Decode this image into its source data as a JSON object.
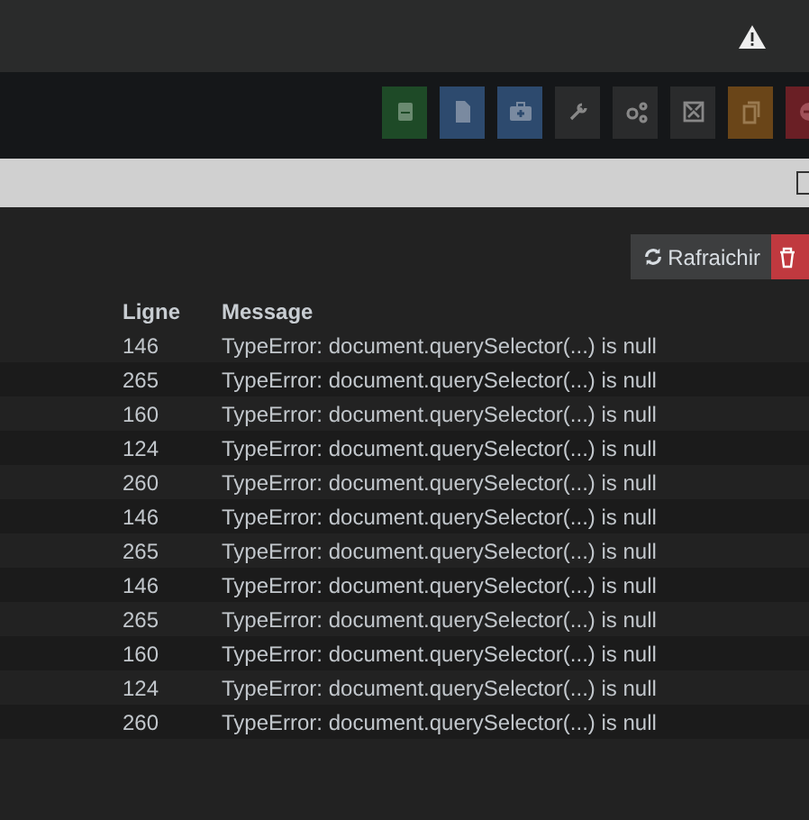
{
  "toolbar": {
    "buttons": [
      {
        "kind": "drive",
        "color": "#1e4a27"
      },
      {
        "kind": "file",
        "color": "#2d4a6e"
      },
      {
        "kind": "case",
        "color": "#2d4a6e"
      },
      {
        "kind": "wrench",
        "color": "#2a2b2c"
      },
      {
        "kind": "gears",
        "color": "#2a2b2c"
      },
      {
        "kind": "frame",
        "color": "#2a2b2c"
      },
      {
        "kind": "copy",
        "color": "#6a4518"
      },
      {
        "kind": "minus",
        "color": "#6a1f25"
      }
    ]
  },
  "filter_bar": {
    "checked": false
  },
  "actions": {
    "refresh": "Rafraichir"
  },
  "table": {
    "columns": [
      "Ligne",
      "Message"
    ],
    "rows": [
      {
        "line": "146",
        "message": "TypeError: document.querySelector(...) is null"
      },
      {
        "line": "265",
        "message": "TypeError: document.querySelector(...) is null"
      },
      {
        "line": "160",
        "message": "TypeError: document.querySelector(...) is null"
      },
      {
        "line": "124",
        "message": "TypeError: document.querySelector(...) is null"
      },
      {
        "line": "260",
        "message": "TypeError: document.querySelector(...) is null"
      },
      {
        "line": "146",
        "message": "TypeError: document.querySelector(...) is null"
      },
      {
        "line": "265",
        "message": "TypeError: document.querySelector(...) is null"
      },
      {
        "line": "146",
        "message": "TypeError: document.querySelector(...) is null"
      },
      {
        "line": "265",
        "message": "TypeError: document.querySelector(...) is null"
      },
      {
        "line": "160",
        "message": "TypeError: document.querySelector(...) is null"
      },
      {
        "line": "124",
        "message": "TypeError: document.querySelector(...) is null"
      },
      {
        "line": "260",
        "message": "TypeError: document.querySelector(...) is null"
      }
    ]
  }
}
